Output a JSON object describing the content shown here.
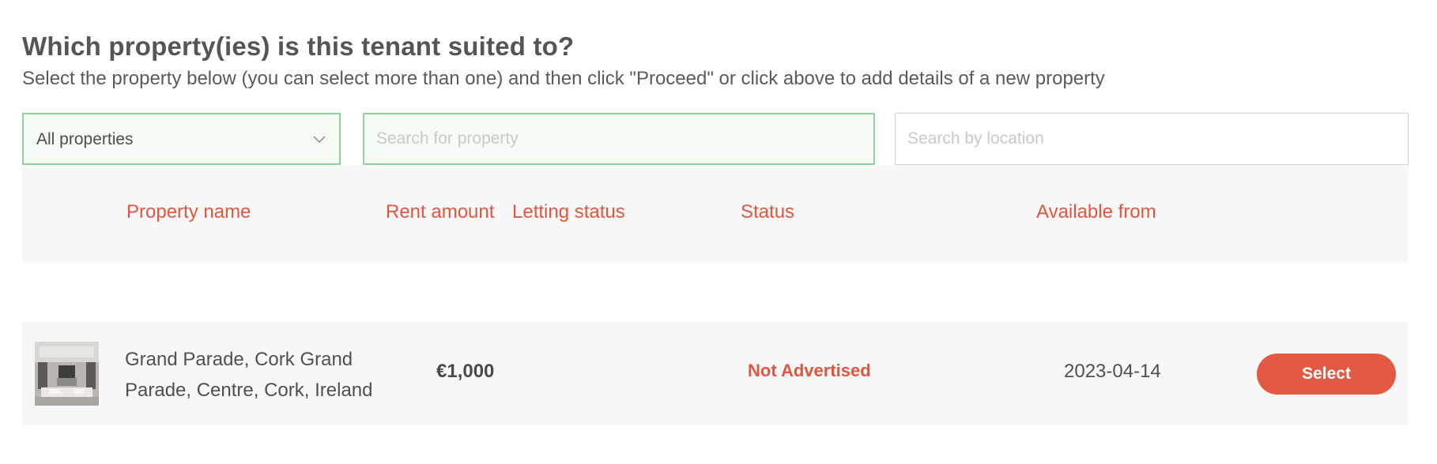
{
  "heading": {
    "title": "Which property(ies) is this tenant suited to?",
    "subtitle": "Select the property below (you can select more than one) and then click \"Proceed\" or click above to add details of a new property"
  },
  "filters": {
    "property_select": {
      "value": "All properties",
      "options": [
        "All properties"
      ]
    },
    "property_search": {
      "value": "",
      "placeholder": "Search for property"
    },
    "location_search": {
      "value": "",
      "placeholder": "Search by location"
    }
  },
  "table": {
    "columns": [
      "Property name",
      "Rent amount",
      "Letting status",
      "Status",
      "Available from"
    ],
    "rows": [
      {
        "thumbnail": "property-photo",
        "property_name": "Grand Parade, Cork   Grand Parade, Centre, Cork, Ireland",
        "rent_amount": "€1,000",
        "letting_status": "",
        "status": "Not Advertised",
        "available_from": "2023-04-14",
        "action_label": "Select"
      }
    ]
  },
  "colors": {
    "accent": "#e2553f",
    "button": "#e35a44",
    "focus_border": "#8fd39a",
    "header_bg": "#f8f8f8",
    "row_bg": "#f7f7f7"
  },
  "icons": {
    "select_chevron": "chevron-down-icon"
  }
}
